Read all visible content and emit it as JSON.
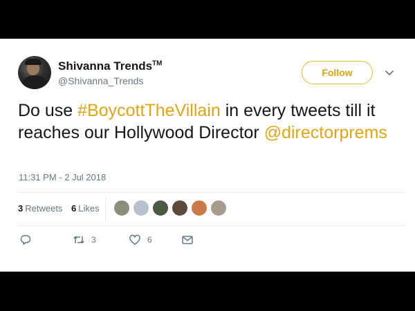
{
  "user": {
    "name": "Shivanna Trends",
    "name_mark": "TM",
    "handle": "@Shivanna_Trends"
  },
  "follow_button": {
    "label": "Follow"
  },
  "tweet": {
    "text_1": "Do use ",
    "hashtag": "#BoycottTheVillain",
    "text_2": " in every tweets till it reaches our Hollywood Director ",
    "mention": "@directorprems",
    "timestamp": "11:31 PM - 2 Jul 2018"
  },
  "stats": {
    "retweets_count": "3",
    "retweets_label": "Retweets",
    "likes_count": "6",
    "likes_label": "Likes"
  },
  "actions": {
    "reply_count": "",
    "retweet_count": "3",
    "like_count": "6"
  },
  "likers": [
    {
      "color": "#8b8f7a"
    },
    {
      "color": "#b8c2cc"
    },
    {
      "color": "#4d5a43"
    },
    {
      "color": "#5c4a3b"
    },
    {
      "color": "#c87a4a"
    },
    {
      "color": "#a89a8c"
    }
  ],
  "colors": {
    "accent": "#e0a513",
    "muted": "#657786",
    "divider": "#e6ecf0"
  },
  "icons": [
    "caret-down-icon",
    "reply-icon",
    "retweet-icon",
    "heart-icon",
    "mail-icon"
  ]
}
